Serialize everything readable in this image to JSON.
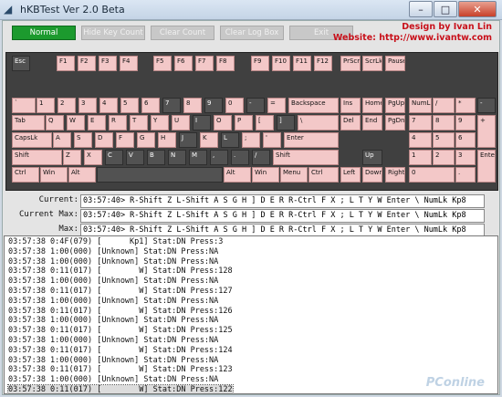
{
  "window": {
    "title": "hKBTest Ver 2.0 Beta",
    "minimize": "–",
    "maximize": "□",
    "close": "✕"
  },
  "toolbar": {
    "buttons": [
      "Normal",
      "Hide Key Count",
      "Clear Count",
      "Clear Log Box",
      "Exit"
    ]
  },
  "credits": {
    "design": "Design by Ivan Lin",
    "website": "Website: http://www.ivantw.com"
  },
  "keyboard": {
    "pressed_color": "#f3c8c8",
    "unpressed_color": "#525252",
    "rows": [
      [
        [
          "Esc",
          0
        ],
        [
          "F1",
          1
        ],
        [
          "F2",
          1
        ],
        [
          "F3",
          1
        ],
        [
          "F4",
          1
        ],
        [
          "F5",
          1
        ],
        [
          "F6",
          1
        ],
        [
          "F7",
          1
        ],
        [
          "F8",
          1
        ],
        [
          "F9",
          1
        ],
        [
          "F10",
          1
        ],
        [
          "F11",
          1
        ],
        [
          "F12",
          1
        ],
        [
          "PrScr",
          1
        ],
        [
          "ScrLk",
          1
        ],
        [
          "Pause",
          1
        ]
      ],
      [
        [
          "`",
          1
        ],
        [
          "1",
          1
        ],
        [
          "2",
          1
        ],
        [
          "3",
          1
        ],
        [
          "4",
          1
        ],
        [
          "5",
          1
        ],
        [
          "6",
          1
        ],
        [
          "7",
          0
        ],
        [
          "8",
          1
        ],
        [
          "9",
          0
        ],
        [
          "0",
          1
        ],
        [
          "-",
          0
        ],
        [
          "=",
          1
        ],
        [
          "Backspace",
          1
        ],
        [
          "Ins",
          1
        ],
        [
          "Home",
          1
        ],
        [
          "PgUp",
          1
        ],
        [
          "NumLk",
          1
        ],
        [
          "/",
          1
        ],
        [
          "*",
          1
        ],
        [
          "-",
          0
        ]
      ],
      [
        [
          "Tab",
          1
        ],
        [
          "Q",
          1
        ],
        [
          "W",
          1
        ],
        [
          "E",
          1
        ],
        [
          "R",
          1
        ],
        [
          "T",
          1
        ],
        [
          "Y",
          1
        ],
        [
          "U",
          1
        ],
        [
          "I",
          0
        ],
        [
          "O",
          1
        ],
        [
          "P",
          1
        ],
        [
          "[",
          1
        ],
        [
          "]",
          0
        ],
        [
          "\\",
          1
        ],
        [
          "Del",
          1
        ],
        [
          "End",
          1
        ],
        [
          "PgDn",
          1
        ],
        [
          "7",
          1
        ],
        [
          "8",
          1
        ],
        [
          "9",
          1
        ],
        [
          "+",
          1
        ]
      ],
      [
        [
          "CapsLk",
          1
        ],
        [
          "A",
          1
        ],
        [
          "S",
          1
        ],
        [
          "D",
          1
        ],
        [
          "F",
          1
        ],
        [
          "G",
          1
        ],
        [
          "H",
          1
        ],
        [
          "J",
          0
        ],
        [
          "K",
          1
        ],
        [
          "L",
          0
        ],
        [
          ";",
          1
        ],
        [
          "'",
          1
        ],
        [
          "Enter",
          1
        ],
        [
          "4",
          1
        ],
        [
          "5",
          1
        ],
        [
          "6",
          1
        ]
      ],
      [
        [
          "Shift",
          1
        ],
        [
          "Z",
          1
        ],
        [
          "X",
          1
        ],
        [
          "C",
          0
        ],
        [
          "V",
          0
        ],
        [
          "B",
          0
        ],
        [
          "N",
          0
        ],
        [
          "M",
          0
        ],
        [
          ",",
          0
        ],
        [
          ".",
          0
        ],
        [
          "/",
          0
        ],
        [
          "Shift",
          1
        ],
        [
          "Up",
          0
        ],
        [
          "1",
          1
        ],
        [
          "2",
          1
        ],
        [
          "3",
          1
        ],
        [
          "Enter",
          1
        ]
      ],
      [
        [
          "Ctrl",
          1
        ],
        [
          "Win",
          1
        ],
        [
          "Alt",
          1
        ],
        [
          "",
          0
        ],
        [
          "Alt",
          1
        ],
        [
          "Win",
          1
        ],
        [
          "Menu",
          1
        ],
        [
          "Ctrl",
          1
        ],
        [
          "Left",
          1
        ],
        [
          "Down",
          1
        ],
        [
          "Right",
          1
        ],
        [
          "0",
          1
        ],
        [
          ".",
          1
        ]
      ]
    ]
  },
  "status": {
    "current_label": "Current:",
    "current": "03:57:40> R-Shift Z L-Shift A S G H ] D E R R-Ctrl F X ; L T Y W Enter \\ NumLk Kp8",
    "current_max_label": "Current Max:",
    "current_max": "03:57:40> R-Shift Z L-Shift A S G H ] D E R R-Ctrl F X ; L T Y W Enter \\ NumLk Kp8",
    "max_label": "Max:",
    "max": "03:57:40> R-Shift Z L-Shift A S G H ] D E R R-Ctrl F X ; L T Y W Enter \\ NumLk Kp8"
  },
  "log": {
    "selected_index": 15,
    "lines": [
      "03:57:38 0:4F(079) [      Kp1] Stat:DN Press:3",
      "03:57:38 1:00(000) [Unknown] Stat:DN Press:NA",
      "03:57:38 1:00(000) [Unknown] Stat:DN Press:NA",
      "03:57:38 0:11(017) [        W] Stat:DN Press:128",
      "03:57:38 1:00(000) [Unknown] Stat:DN Press:NA",
      "03:57:38 0:11(017) [        W] Stat:DN Press:127",
      "03:57:38 1:00(000) [Unknown] Stat:DN Press:NA",
      "03:57:38 0:11(017) [        W] Stat:DN Press:126",
      "03:57:38 1:00(000) [Unknown] Stat:DN Press:NA",
      "03:57:38 0:11(017) [        W] Stat:DN Press:125",
      "03:57:38 1:00(000) [Unknown] Stat:DN Press:NA",
      "03:57:38 0:11(017) [        W] Stat:DN Press:124",
      "03:57:38 1:00(000) [Unknown] Stat:DN Press:NA",
      "03:57:38 0:11(017) [        W] Stat:DN Press:123",
      "03:57:38 1:00(000) [Unknown] Stat:DN Press:NA",
      "03:57:38 0:11(017) [        W] Stat:DN Press:122"
    ]
  },
  "watermark": "PConline"
}
